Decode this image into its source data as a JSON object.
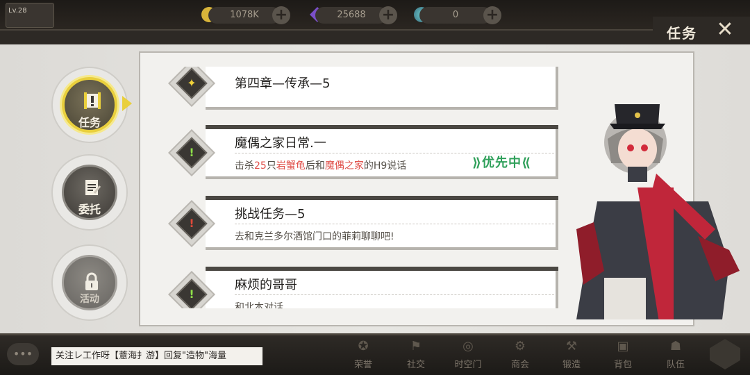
{
  "header": {
    "level": "Lv.28",
    "resources": [
      {
        "name": "gold",
        "value": "1078K",
        "icon": "coin-icon",
        "color": "#d8b43a"
      },
      {
        "name": "crystal",
        "value": "25688",
        "icon": "crystal-icon",
        "color": "#7a4fc8"
      },
      {
        "name": "orb",
        "value": "0",
        "icon": "orb-icon",
        "color": "#4a8fa0"
      }
    ],
    "title": "任务",
    "close_icon": "close-icon"
  },
  "sidebar": {
    "tabs": [
      {
        "label": "任务",
        "icon": "scroll-icon",
        "active": true
      },
      {
        "label": "委托",
        "icon": "contract-icon",
        "active": false
      },
      {
        "label": "活动",
        "icon": "lock-icon",
        "active": false,
        "locked": true
      }
    ]
  },
  "quests": [
    {
      "title": "第四章—传承—5",
      "desc": [],
      "icon_color": "#f0d23a",
      "icon_mark": "✦",
      "priority": ""
    },
    {
      "title": "魔偶之家日常.一",
      "desc": [
        {
          "text": "击杀",
          "hl": false
        },
        {
          "text": "25",
          "hl": true
        },
        {
          "text": "只",
          "hl": false
        },
        {
          "text": "岩蟹龟",
          "hl": true
        },
        {
          "text": "后和",
          "hl": false
        },
        {
          "text": "魔偶之家",
          "hl": true
        },
        {
          "text": "的H9说话",
          "hl": false
        }
      ],
      "icon_color": "#8fe04a",
      "icon_mark": "!",
      "priority": "优先中"
    },
    {
      "title": "挑战任务—5",
      "desc": [
        {
          "text": "去和克兰多尔酒馆门口的菲莉聊聊吧!",
          "hl": false
        }
      ],
      "icon_color": "#e04a3a",
      "icon_mark": "!",
      "priority": ""
    },
    {
      "title": "麻烦的哥哥",
      "desc": [
        {
          "text": "和北本对话",
          "hl": false
        }
      ],
      "icon_color": "#8fe04a",
      "icon_mark": "!",
      "priority": ""
    }
  ],
  "chat": {
    "icon": "chat-bubble-icon",
    "message": "关注レ工作呀【薏海扌游】回复\"造物\"海量"
  },
  "bottom_nav": [
    {
      "label": "荣誉",
      "icon": "honor-icon"
    },
    {
      "label": "社交",
      "icon": "social-icon"
    },
    {
      "label": "时空门",
      "icon": "portal-icon"
    },
    {
      "label": "商会",
      "icon": "shop-icon"
    },
    {
      "label": "锻造",
      "icon": "forge-icon"
    },
    {
      "label": "背包",
      "icon": "bag-icon"
    },
    {
      "label": "队伍",
      "icon": "team-icon"
    }
  ],
  "menu_icon": "hex-menu-icon"
}
